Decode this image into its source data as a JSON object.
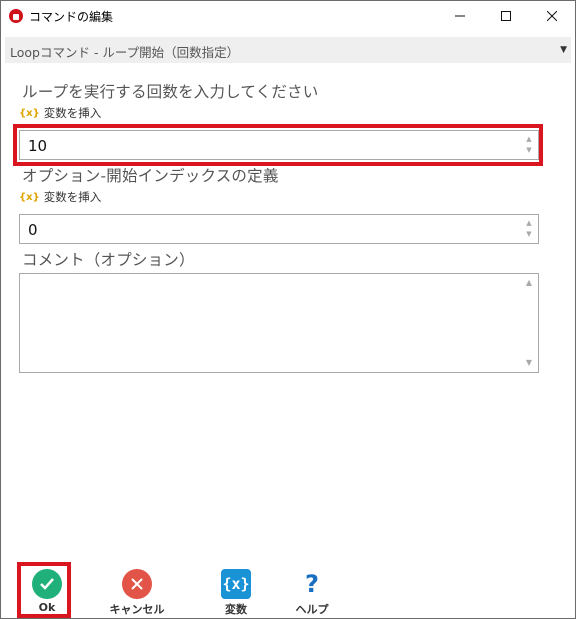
{
  "window": {
    "title": "コマンドの編集",
    "controls": {
      "minimize": "minimize",
      "maximize": "maximize",
      "close": "close"
    }
  },
  "command_select": {
    "value": "Loopコマンド - ループ開始（回数指定）"
  },
  "fields": [
    {
      "label": "ループを実行する回数を入力してください",
      "insert_variable": "変数を挿入",
      "value": "10",
      "highlighted": true
    },
    {
      "label": "オプション-開始インデックスの定義",
      "insert_variable": "変数を挿入",
      "value": "0",
      "highlighted": false
    },
    {
      "label": "コメント（オプション）",
      "value": ""
    }
  ],
  "footer": {
    "ok": "Ok",
    "cancel": "キャンセル",
    "variables": "変数",
    "help": "ヘルプ",
    "var_icon_text": "{x}",
    "help_icon_text": "?"
  },
  "colors": {
    "highlight": "#d9161f",
    "ok": "#20b07a",
    "cancel": "#e15447",
    "variable": "#1a92d6",
    "help": "#1a6fc0"
  }
}
